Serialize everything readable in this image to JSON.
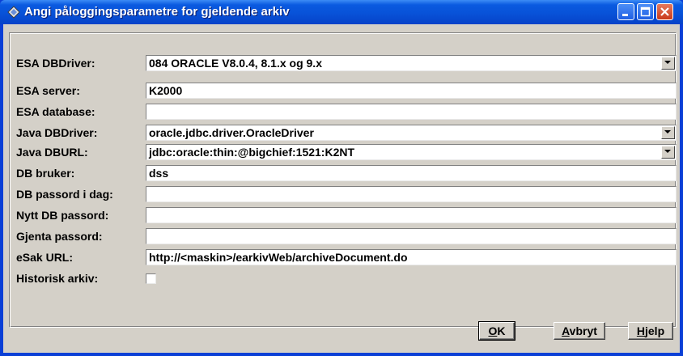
{
  "window": {
    "title": "Angi påloggingsparametre for gjeldende arkiv",
    "minimize_icon": "minimize-icon",
    "maximize_icon": "maximize-icon",
    "close_icon": "close-icon"
  },
  "form": {
    "rows": [
      {
        "label": "ESA DBDriver:",
        "value": "084 ORACLE V8.0.4, 8.1.x og 9.x",
        "type": "combo"
      },
      {
        "label": "ESA server:",
        "value": "K2000",
        "type": "text"
      },
      {
        "label": "ESA database:",
        "value": "",
        "type": "text"
      },
      {
        "label": "Java DBDriver:",
        "value": "oracle.jdbc.driver.OracleDriver",
        "type": "combo"
      },
      {
        "label": "Java DBURL:",
        "value": "jdbc:oracle:thin:@bigchief:1521:K2NT",
        "type": "combo"
      },
      {
        "label": "DB bruker:",
        "value": "dss",
        "type": "text"
      },
      {
        "label": "DB passord i dag:",
        "value": "",
        "type": "password"
      },
      {
        "label": "Nytt DB passord:",
        "value": "",
        "type": "password"
      },
      {
        "label": "Gjenta passord:",
        "value": "",
        "type": "password"
      },
      {
        "label": "eSak URL:",
        "value": "http://<maskin>/earkivWeb/archiveDocument.do",
        "type": "text"
      }
    ],
    "historisk": {
      "label": "Historisk arkiv:",
      "checked": false
    }
  },
  "buttons": {
    "ok": {
      "mnemonic": "O",
      "rest": "K"
    },
    "avbryt": {
      "mnemonic": "A",
      "rest": "vbryt"
    },
    "hjelp": {
      "mnemonic": "H",
      "rest": "jelp"
    }
  }
}
